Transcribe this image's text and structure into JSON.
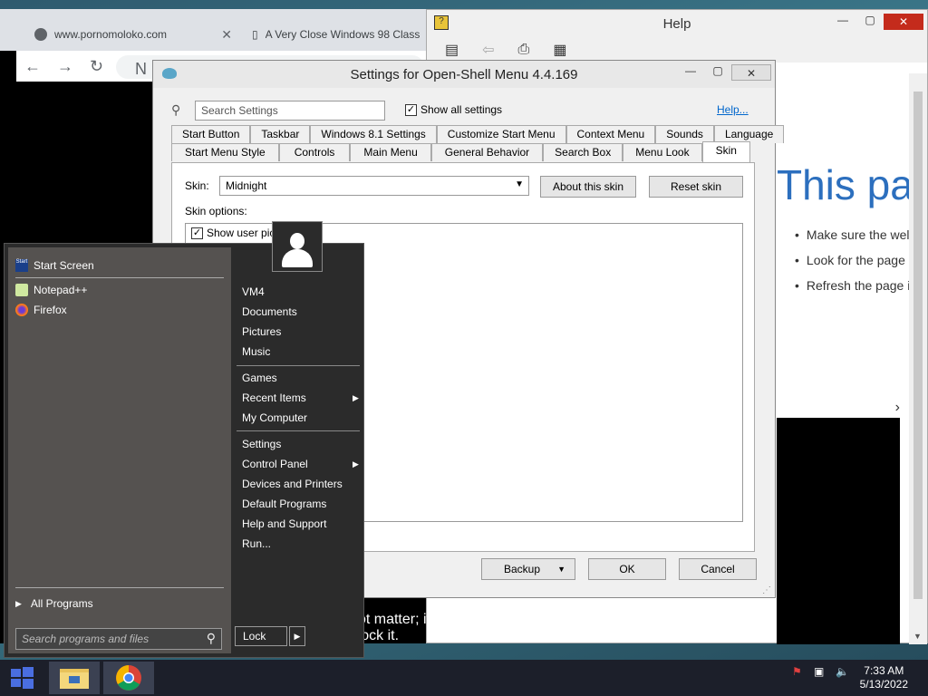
{
  "browser": {
    "tabs": [
      {
        "label": "www.pornomoloko.com"
      },
      {
        "label": "A Very Close Windows 98 Class"
      }
    ],
    "omnibox": "N",
    "overlay_text_line1": "that appears may not matter; if the site is blocked rightfully an",
    "overlay_text_line2": "unblock it."
  },
  "help": {
    "title": "Help",
    "heading": "This pag",
    "bullets": [
      "Make sure the wel",
      "Look for the page",
      "Refresh the page i"
    ]
  },
  "settings": {
    "title": "Settings for Open-Shell Menu 4.4.169",
    "search_placeholder": "Search Settings",
    "show_all": "Show all settings",
    "help_link": "Help...",
    "tabs_row1": [
      "Start Button",
      "Taskbar",
      "Windows 8.1 Settings",
      "Customize Start Menu",
      "Context Menu",
      "Sounds",
      "Language"
    ],
    "tabs_row2": [
      "Start Menu Style",
      "Controls",
      "Main Menu",
      "General Behavior",
      "Search Box",
      "Menu Look",
      "Skin"
    ],
    "skin_label": "Skin:",
    "skin_value": "Midnight",
    "about_skin": "About this skin",
    "reset_skin": "Reset skin",
    "skin_options_label": "Skin options:",
    "option_show_user_pic": "Show user pic",
    "backup": "Backup",
    "ok": "OK",
    "cancel": "Cancel"
  },
  "startmenu": {
    "left": [
      "Start Screen",
      "Notepad++",
      "Firefox"
    ],
    "all_programs": "All Programs",
    "search_placeholder": "Search programs and files",
    "right_group1": [
      "VM4",
      "Documents",
      "Pictures",
      "Music"
    ],
    "right_group2": [
      "Games",
      "Recent Items",
      "My Computer"
    ],
    "right_group3": [
      "Settings",
      "Control Panel",
      "Devices and Printers",
      "Default Programs",
      "Help and Support",
      "Run..."
    ],
    "lock": "Lock"
  },
  "taskbar": {
    "time": "7:33 AM",
    "date": "5/13/2022"
  },
  "colors": {
    "accent_blue": "#2c6fbe",
    "close_red": "#c42b1c",
    "menu_dark": "#2b2b2b"
  }
}
